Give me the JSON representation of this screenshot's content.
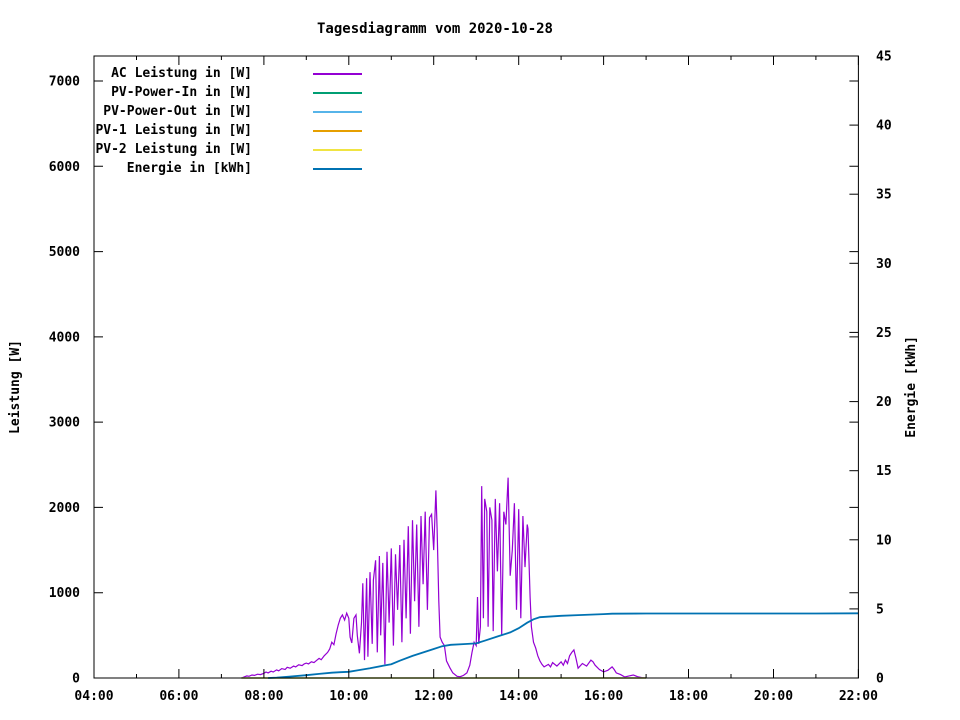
{
  "chart_data": {
    "type": "line",
    "title": "Tagesdiagramm vom 2020-10-28",
    "ylabel": "Leistung [W]",
    "y2label": "Energie [kWh]",
    "grid": false,
    "legend_position": "top-left-inside",
    "x_axis": {
      "unit": "time",
      "range_hours": [
        4,
        22
      ],
      "major_ticks": [
        {
          "hour": 4,
          "label": "04:00"
        },
        {
          "hour": 6,
          "label": "06:00"
        },
        {
          "hour": 8,
          "label": "08:00"
        },
        {
          "hour": 10,
          "label": "10:00"
        },
        {
          "hour": 12,
          "label": "12:00"
        },
        {
          "hour": 14,
          "label": "14:00"
        },
        {
          "hour": 16,
          "label": "16:00"
        },
        {
          "hour": 18,
          "label": "18:00"
        },
        {
          "hour": 20,
          "label": "20:00"
        },
        {
          "hour": 22,
          "label": "22:00"
        }
      ],
      "minor_tick_hours": [
        5,
        7,
        9,
        11,
        13,
        15,
        17,
        19,
        21
      ]
    },
    "y_axis": {
      "range": [
        0,
        7300
      ],
      "tick_values": [
        0,
        1000,
        2000,
        3000,
        4000,
        5000,
        6000,
        7000
      ],
      "tick_labels": [
        "0",
        "1000",
        "2000",
        "3000",
        "4000",
        "5000",
        "6000",
        "7000"
      ]
    },
    "y2_axis": {
      "range": [
        0,
        45
      ],
      "tick_values": [
        0,
        5,
        10,
        15,
        20,
        25,
        30,
        35,
        40,
        45
      ],
      "tick_labels": [
        "0",
        "5",
        "10",
        "15",
        "20",
        "25",
        "30",
        "35",
        "40",
        "45"
      ]
    },
    "series": [
      {
        "name": "AC Leistung in [W]",
        "color": "#9400d3",
        "axis": "y1",
        "stroke_width": 1.2,
        "points": [
          [
            7.47,
            0
          ],
          [
            7.55,
            15
          ],
          [
            7.6,
            25
          ],
          [
            7.65,
            20
          ],
          [
            7.72,
            35
          ],
          [
            7.78,
            30
          ],
          [
            7.85,
            45
          ],
          [
            7.92,
            40
          ],
          [
            8.0,
            55
          ],
          [
            8.05,
            70
          ],
          [
            8.1,
            60
          ],
          [
            8.17,
            80
          ],
          [
            8.22,
            70
          ],
          [
            8.3,
            95
          ],
          [
            8.35,
            85
          ],
          [
            8.42,
            110
          ],
          [
            8.5,
            100
          ],
          [
            8.55,
            125
          ],
          [
            8.62,
            115
          ],
          [
            8.7,
            140
          ],
          [
            8.75,
            130
          ],
          [
            8.82,
            155
          ],
          [
            8.9,
            145
          ],
          [
            8.95,
            165
          ],
          [
            9.0,
            175
          ],
          [
            9.05,
            165
          ],
          [
            9.12,
            190
          ],
          [
            9.18,
            180
          ],
          [
            9.25,
            210
          ],
          [
            9.3,
            230
          ],
          [
            9.35,
            215
          ],
          [
            9.42,
            260
          ],
          [
            9.5,
            300
          ],
          [
            9.55,
            340
          ],
          [
            9.6,
            420
          ],
          [
            9.65,
            390
          ],
          [
            9.7,
            520
          ],
          [
            9.75,
            620
          ],
          [
            9.8,
            700
          ],
          [
            9.85,
            740
          ],
          [
            9.9,
            680
          ],
          [
            9.95,
            760
          ],
          [
            10.0,
            700
          ],
          [
            10.03,
            480
          ],
          [
            10.07,
            410
          ],
          [
            10.12,
            700
          ],
          [
            10.17,
            740
          ],
          [
            10.2,
            500
          ],
          [
            10.25,
            290
          ],
          [
            10.3,
            650
          ],
          [
            10.33,
            1110
          ],
          [
            10.37,
            210
          ],
          [
            10.42,
            1170
          ],
          [
            10.45,
            250
          ],
          [
            10.5,
            1240
          ],
          [
            10.55,
            400
          ],
          [
            10.58,
            1150
          ],
          [
            10.63,
            1380
          ],
          [
            10.67,
            300
          ],
          [
            10.72,
            1430
          ],
          [
            10.75,
            500
          ],
          [
            10.8,
            1350
          ],
          [
            10.85,
            160
          ],
          [
            10.9,
            1480
          ],
          [
            10.95,
            650
          ],
          [
            11.0,
            1520
          ],
          [
            11.05,
            380
          ],
          [
            11.1,
            1450
          ],
          [
            11.15,
            800
          ],
          [
            11.2,
            1560
          ],
          [
            11.25,
            420
          ],
          [
            11.3,
            1620
          ],
          [
            11.35,
            700
          ],
          [
            11.4,
            1780
          ],
          [
            11.45,
            520
          ],
          [
            11.5,
            1850
          ],
          [
            11.55,
            900
          ],
          [
            11.6,
            1800
          ],
          [
            11.65,
            600
          ],
          [
            11.7,
            1900
          ],
          [
            11.75,
            1100
          ],
          [
            11.8,
            1950
          ],
          [
            11.85,
            800
          ],
          [
            11.9,
            1880
          ],
          [
            11.95,
            1920
          ],
          [
            12.0,
            1500
          ],
          [
            12.05,
            2200
          ],
          [
            12.08,
            1750
          ],
          [
            12.12,
            900
          ],
          [
            12.15,
            480
          ],
          [
            12.2,
            420
          ],
          [
            12.25,
            380
          ],
          [
            12.3,
            200
          ],
          [
            12.38,
            120
          ],
          [
            12.45,
            60
          ],
          [
            12.55,
            20
          ],
          [
            12.62,
            15
          ],
          [
            12.7,
            30
          ],
          [
            12.78,
            60
          ],
          [
            12.85,
            150
          ],
          [
            12.9,
            300
          ],
          [
            12.95,
            420
          ],
          [
            13.0,
            380
          ],
          [
            13.03,
            950
          ],
          [
            13.06,
            400
          ],
          [
            13.1,
            600
          ],
          [
            13.13,
            2250
          ],
          [
            13.17,
            700
          ],
          [
            13.2,
            2100
          ],
          [
            13.25,
            1950
          ],
          [
            13.28,
            600
          ],
          [
            13.32,
            2000
          ],
          [
            13.37,
            1850
          ],
          [
            13.4,
            550
          ],
          [
            13.45,
            2100
          ],
          [
            13.5,
            1250
          ],
          [
            13.55,
            2050
          ],
          [
            13.6,
            500
          ],
          [
            13.65,
            1950
          ],
          [
            13.7,
            1800
          ],
          [
            13.75,
            2350
          ],
          [
            13.8,
            1200
          ],
          [
            13.85,
            1500
          ],
          [
            13.9,
            2050
          ],
          [
            13.95,
            800
          ],
          [
            14.0,
            1980
          ],
          [
            14.05,
            700
          ],
          [
            14.1,
            1900
          ],
          [
            14.15,
            1300
          ],
          [
            14.2,
            1800
          ],
          [
            14.22,
            1750
          ],
          [
            14.27,
            950
          ],
          [
            14.3,
            600
          ],
          [
            14.35,
            420
          ],
          [
            14.4,
            350
          ],
          [
            14.45,
            260
          ],
          [
            14.5,
            200
          ],
          [
            14.55,
            160
          ],
          [
            14.6,
            130
          ],
          [
            14.7,
            160
          ],
          [
            14.75,
            130
          ],
          [
            14.8,
            180
          ],
          [
            14.9,
            140
          ],
          [
            15.0,
            190
          ],
          [
            15.05,
            150
          ],
          [
            15.1,
            210
          ],
          [
            15.15,
            170
          ],
          [
            15.2,
            260
          ],
          [
            15.25,
            300
          ],
          [
            15.3,
            330
          ],
          [
            15.35,
            230
          ],
          [
            15.4,
            115
          ],
          [
            15.5,
            170
          ],
          [
            15.6,
            140
          ],
          [
            15.7,
            210
          ],
          [
            15.75,
            190
          ],
          [
            15.8,
            150
          ],
          [
            15.9,
            100
          ],
          [
            16.0,
            72
          ],
          [
            16.1,
            90
          ],
          [
            16.2,
            130
          ],
          [
            16.25,
            100
          ],
          [
            16.3,
            60
          ],
          [
            16.4,
            40
          ],
          [
            16.5,
            12
          ],
          [
            16.6,
            25
          ],
          [
            16.7,
            35
          ],
          [
            16.8,
            15
          ],
          [
            16.9,
            5
          ],
          [
            17.0,
            0
          ]
        ]
      },
      {
        "name": "PV-Power-In in [W]",
        "color": "#009e73",
        "axis": "y1",
        "stroke_width": 1.2,
        "points": [
          [
            7.47,
            0
          ],
          [
            17.0,
            0
          ]
        ]
      },
      {
        "name": "PV-Power-Out in [W]",
        "color": "#56b4e9",
        "axis": "y1",
        "stroke_width": 1.2,
        "points": [
          [
            7.47,
            0
          ],
          [
            17.0,
            0
          ]
        ]
      },
      {
        "name": "PV-1 Leistung in [W]",
        "color": "#e69f00",
        "axis": "y1",
        "stroke_width": 1.2,
        "points": [
          [
            7.47,
            0
          ],
          [
            17.0,
            0
          ]
        ]
      },
      {
        "name": "PV-2 Leistung in [W]",
        "color": "#f0e442",
        "axis": "y1",
        "stroke_width": 1.2,
        "points": [
          [
            7.47,
            0
          ],
          [
            17.0,
            0
          ]
        ]
      },
      {
        "name": "Energie in [kWh]",
        "color": "#0072b2",
        "axis": "y2",
        "stroke_width": 1.8,
        "points": [
          [
            8.1,
            0
          ],
          [
            8.3,
            0.03
          ],
          [
            8.6,
            0.1
          ],
          [
            9.0,
            0.2
          ],
          [
            9.3,
            0.3
          ],
          [
            9.6,
            0.38
          ],
          [
            9.8,
            0.42
          ],
          [
            10.0,
            0.45
          ],
          [
            10.2,
            0.55
          ],
          [
            10.5,
            0.7
          ],
          [
            10.8,
            0.88
          ],
          [
            11.0,
            1.0
          ],
          [
            11.2,
            1.25
          ],
          [
            11.5,
            1.6
          ],
          [
            11.7,
            1.8
          ],
          [
            12.0,
            2.1
          ],
          [
            12.2,
            2.3
          ],
          [
            12.4,
            2.4
          ],
          [
            12.7,
            2.45
          ],
          [
            13.0,
            2.5
          ],
          [
            13.2,
            2.7
          ],
          [
            13.5,
            3.0
          ],
          [
            13.8,
            3.3
          ],
          [
            14.0,
            3.6
          ],
          [
            14.2,
            4.0
          ],
          [
            14.35,
            4.25
          ],
          [
            14.5,
            4.4
          ],
          [
            15.0,
            4.5
          ],
          [
            15.4,
            4.55
          ],
          [
            16.0,
            4.62
          ],
          [
            16.2,
            4.65
          ],
          [
            17.0,
            4.67
          ],
          [
            18.0,
            4.67
          ],
          [
            19.0,
            4.67
          ],
          [
            20.0,
            4.67
          ],
          [
            21.0,
            4.67
          ],
          [
            22.0,
            4.68
          ]
        ]
      }
    ]
  }
}
